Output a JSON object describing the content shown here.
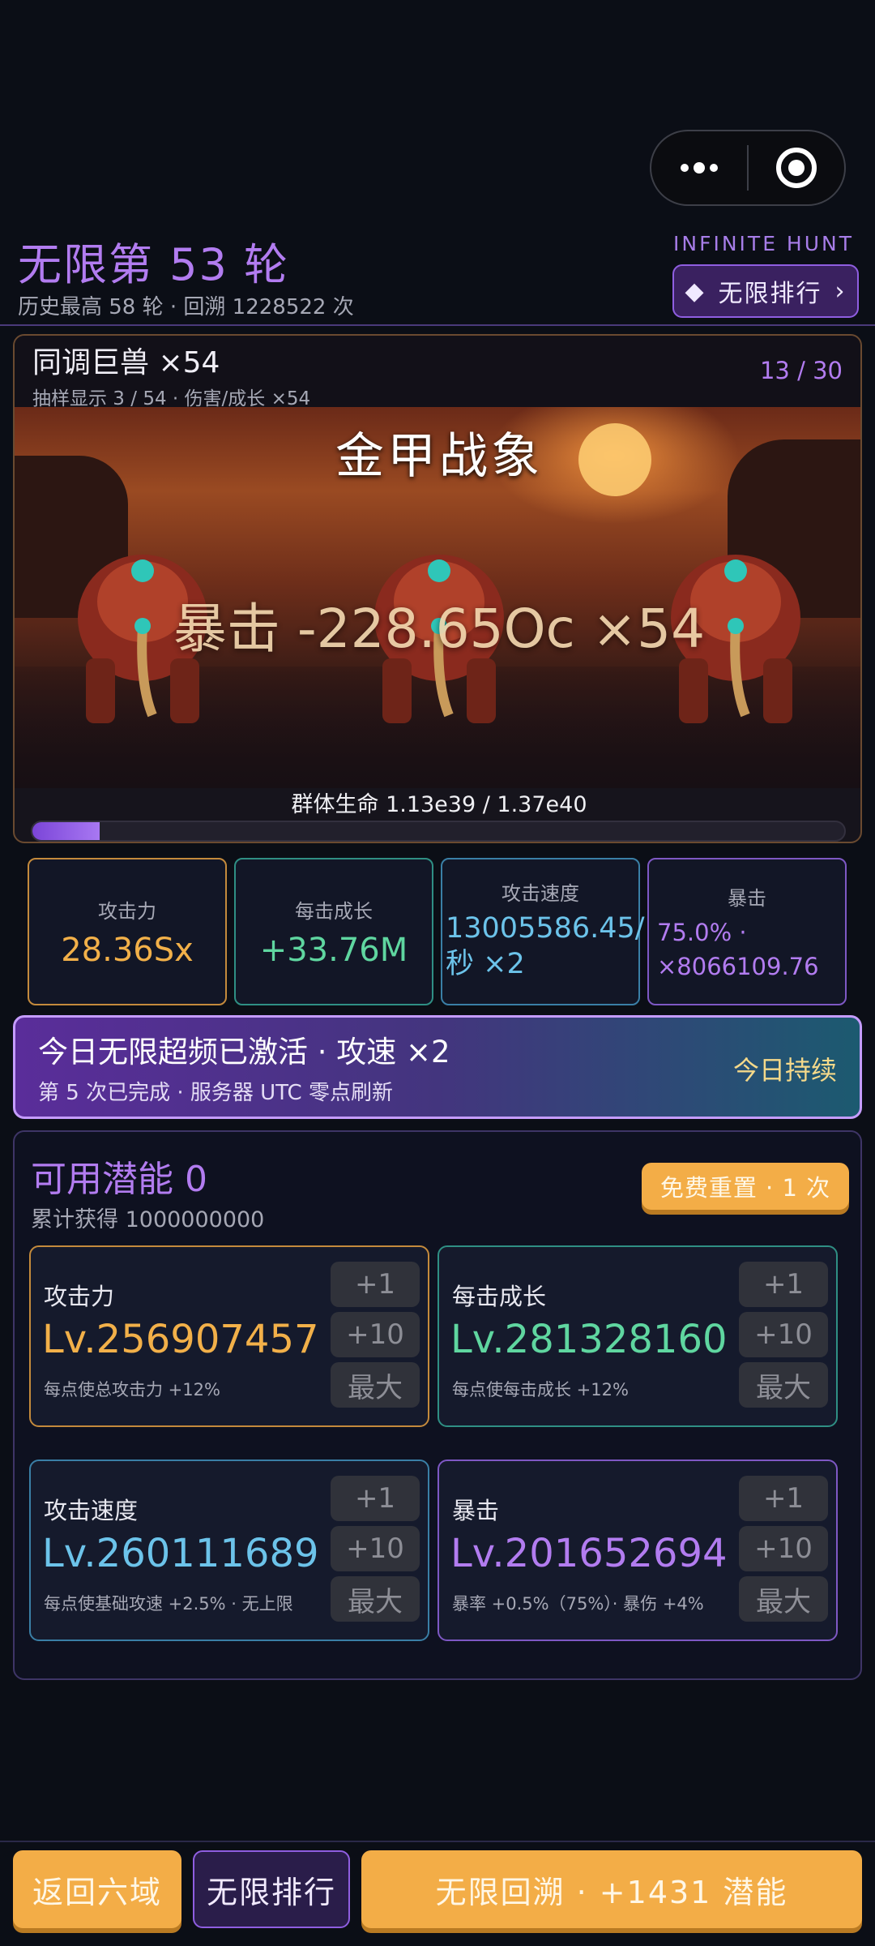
{
  "header": {
    "round_title": "无限第 53 轮",
    "round_sub": "历史最高 58 轮 · 回溯 1228522 次",
    "hunt_label": "INFINITE HUNT",
    "rank_button": "无限排行",
    "rank_icon": "◆",
    "rank_chevron": "›"
  },
  "boss": {
    "name": "同调巨兽 ×54",
    "sub": "抽样显示 3 / 54 · 伤害/成长 ×54",
    "count": "13 / 30",
    "title": "金甲战象",
    "crit_text": "暴击 -228.65Oc ×54",
    "hp_label": "群体生命 1.13e39 / 1.37e40",
    "hp_fraction": 0.0825
  },
  "stats": [
    {
      "label": "攻击力",
      "value": "28.36Sx",
      "color": "#f2b049"
    },
    {
      "label": "每击成长",
      "value": "+33.76M",
      "color": "#5fd6a0"
    },
    {
      "label": "攻击速度",
      "value": "13005586.45/秒 ×2",
      "color": "#6cc3ea"
    },
    {
      "label": "暴击",
      "value": "75.0% · ×8066109.76",
      "color": "#b27cf0"
    }
  ],
  "overclock": {
    "title": "今日无限超频已激活 · 攻速 ×2",
    "sub": "第 5 次已完成 · 服务器 UTC 零点刷新",
    "right": "今日持续"
  },
  "potential": {
    "title": "可用潜能 0",
    "sub": "累计获得 1000000000",
    "reset_button": "免费重置 · 1 次",
    "btn_plus1": "+1",
    "btn_plus10": "+10",
    "btn_max": "最大",
    "cards": [
      {
        "name": "攻击力",
        "level": "Lv.256907457",
        "desc": "每点使总攻击力 +12%",
        "color": "#f2b049"
      },
      {
        "name": "每击成长",
        "level": "Lv.281328160",
        "desc": "每点使每击成长 +12%",
        "color": "#5fd6a0"
      },
      {
        "name": "攻击速度",
        "level": "Lv.260111689",
        "desc": "每点使基础攻速 +2.5% · 无上限",
        "color": "#6cc3ea"
      },
      {
        "name": "暴击",
        "level": "Lv.201652694",
        "desc": "暴率 +0.5%（75%）· 暴伤 +4%",
        "color": "#b27cf0"
      }
    ]
  },
  "bottom": {
    "back": "返回六域",
    "rank": "无限排行",
    "rebirth": "无限回溯 · +1431 潜能"
  }
}
